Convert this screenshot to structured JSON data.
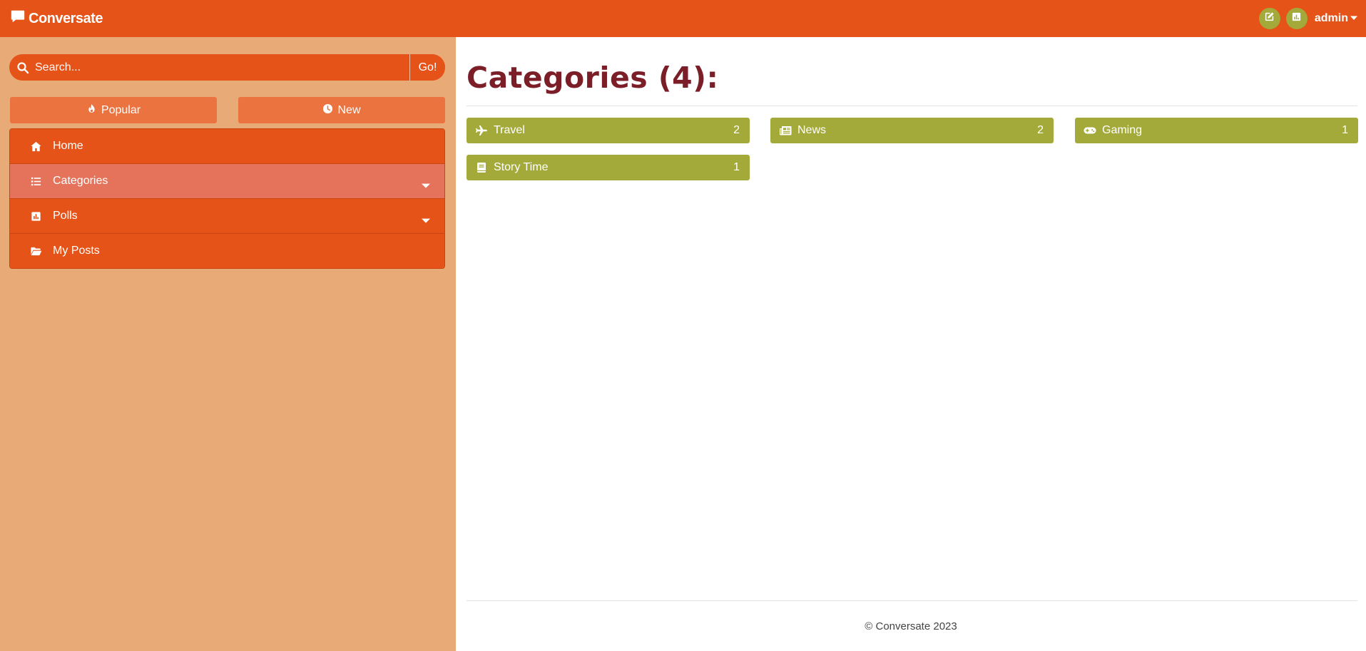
{
  "app": {
    "brand": "Conversate",
    "brand_icon": "comment-icon"
  },
  "navbar": {
    "new_post_icon": "edit-icon",
    "stats_icon": "chart-icon",
    "username": "admin"
  },
  "search": {
    "placeholder": "Search...",
    "value": "",
    "go_label": "Go!"
  },
  "sort": {
    "popular_label": "Popular",
    "new_label": "New"
  },
  "menu": [
    {
      "label": "Home",
      "icon": "home-icon"
    },
    {
      "label": "Categories",
      "icon": "list-icon",
      "active": true,
      "dropdown": true
    },
    {
      "label": "Polls",
      "icon": "poll-icon",
      "dropdown": true
    },
    {
      "label": "My Posts",
      "icon": "folder-open-icon"
    }
  ],
  "main": {
    "title": "Categories (4):",
    "categories": [
      {
        "name": "Travel",
        "count": "2",
        "icon": "plane-icon"
      },
      {
        "name": "News",
        "count": "2",
        "icon": "newspaper-icon"
      },
      {
        "name": "Gaming",
        "count": "1",
        "icon": "gamepad-icon"
      },
      {
        "name": "Story Time",
        "count": "1",
        "icon": "book-icon"
      }
    ]
  },
  "footer": {
    "text": "© Conversate 2023"
  },
  "colors": {
    "primary": "#e55318",
    "sidebar_bg": "#e8aa77",
    "accent": "#a3aa3a",
    "title": "#7b1e28",
    "active_item": "#e5735b"
  }
}
